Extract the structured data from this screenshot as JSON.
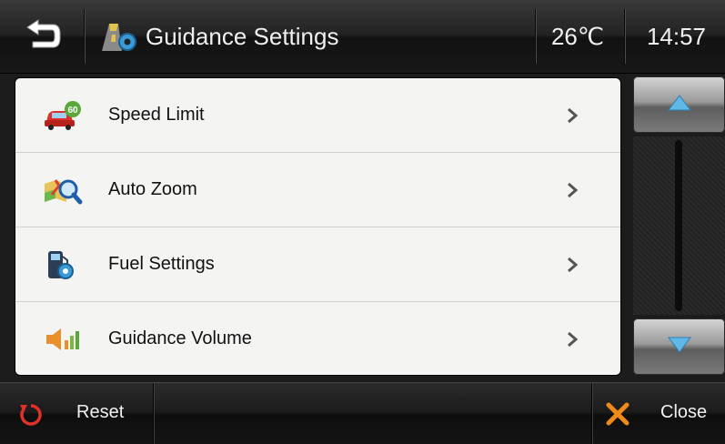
{
  "header": {
    "title": "Guidance Settings",
    "temperature": "26℃",
    "time": "14:57",
    "back_icon": "back-arrow-icon",
    "title_icon": "guidance-settings-icon"
  },
  "menu": {
    "items": [
      {
        "label": "Speed Limit",
        "icon": "speed-limit-car-icon",
        "icon_badge": "60"
      },
      {
        "label": "Auto Zoom",
        "icon": "auto-zoom-map-icon"
      },
      {
        "label": "Fuel Settings",
        "icon": "fuel-pump-gear-icon"
      },
      {
        "label": "Guidance Volume",
        "icon": "speaker-volume-icon"
      }
    ]
  },
  "footer": {
    "reset_label": "Reset",
    "close_label": "Close"
  },
  "colors": {
    "list_background": "#f4f4f2",
    "scroll_arrow": "#5fb8e6",
    "close_x": "#f08a1a",
    "reset_icon": "#e0302a"
  }
}
